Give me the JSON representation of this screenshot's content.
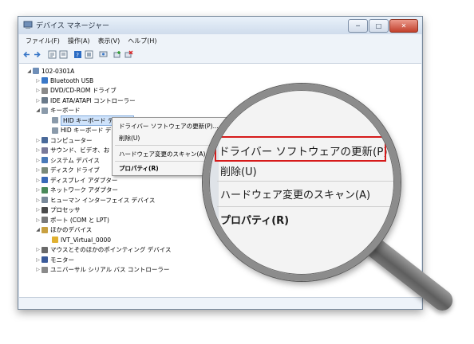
{
  "window": {
    "title": "デバイス マネージャー",
    "buttons": {
      "minimize": "─",
      "maximize": "□",
      "close": "✕"
    }
  },
  "menubar": [
    "ファイル(F)",
    "操作(A)",
    "表示(V)",
    "ヘルプ(H)"
  ],
  "toolbar_icons": [
    "back-icon",
    "forward-icon",
    "tree-icon",
    "properties-icon",
    "help-icon",
    "view-icon",
    "scan-icon",
    "update-driver-icon",
    "uninstall-icon"
  ],
  "tree": {
    "root": "102-0301A",
    "items": [
      {
        "label": "Bluetooth USB",
        "icon": "bluetooth-icon",
        "expander": "▷"
      },
      {
        "label": "DVD/CD-ROM ドライブ",
        "icon": "dvd-icon",
        "expander": "▷"
      },
      {
        "label": "IDE ATA/ATAPI コントローラー",
        "icon": "ide-icon",
        "expander": "▷"
      },
      {
        "label": "キーボード",
        "icon": "keyboard-icon",
        "expander": "◢"
      },
      {
        "label": "HID キーボード デバイス",
        "icon": "keyboard-icon",
        "expander": "",
        "child": true,
        "selected": true
      },
      {
        "label": "HID キーボード デ",
        "icon": "keyboard-icon",
        "expander": "",
        "child": true
      },
      {
        "label": "コンピューター",
        "icon": "computer-icon",
        "expander": "▷"
      },
      {
        "label": "サウンド、ビデオ、お",
        "icon": "sound-icon",
        "expander": "▷"
      },
      {
        "label": "システム デバイス",
        "icon": "system-icon",
        "expander": "▷"
      },
      {
        "label": "ディスク ドライブ",
        "icon": "disk-icon",
        "expander": "▷"
      },
      {
        "label": "ディスプレイ アダプター",
        "icon": "display-icon",
        "expander": "▷"
      },
      {
        "label": "ネットワーク アダプター",
        "icon": "network-icon",
        "expander": "▷"
      },
      {
        "label": "ヒューマン インターフェイス デバイス",
        "icon": "hid-icon",
        "expander": "▷"
      },
      {
        "label": "プロセッサ",
        "icon": "processor-icon",
        "expander": "▷"
      },
      {
        "label": "ポート (COM と LPT)",
        "icon": "port-icon",
        "expander": "▷"
      },
      {
        "label": "ほかのデバイス",
        "icon": "other-device-icon",
        "expander": "◢"
      },
      {
        "label": "IVT_Virtual_0000",
        "icon": "warning-device-icon",
        "expander": "",
        "child": true
      },
      {
        "label": "マウスとそのほかのポインティング デバイス",
        "icon": "mouse-icon",
        "expander": "▷"
      },
      {
        "label": "モニター",
        "icon": "monitor-icon",
        "expander": "▷"
      },
      {
        "label": "ユニバーサル シリアル バス コントローラー",
        "icon": "usb-icon",
        "expander": "▷"
      }
    ]
  },
  "context_menu": {
    "items": [
      "ドライバー ソフトウェアの更新(P)...",
      "削除(U)",
      "ハードウェア変更のスキャン(A)",
      "プロパティ(R)"
    ]
  },
  "magnifier": {
    "items": [
      "ドライバー ソフトウェアの更新(P)",
      "削除(U)",
      "ハードウェア変更のスキャン(A)",
      "プロパティ(R)"
    ],
    "highlight_color": "#d61a1a"
  },
  "colors": {
    "selection": "#cfe3fb",
    "window_frame": "#dce6f2"
  }
}
